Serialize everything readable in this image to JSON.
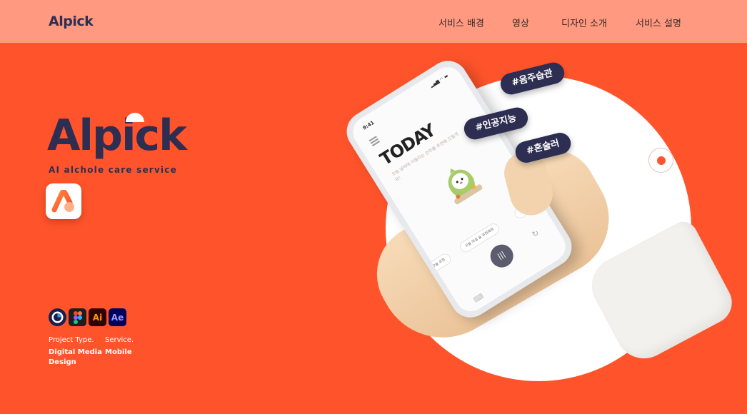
{
  "header": {
    "logo": "Alpick",
    "nav": [
      "서비스 배경",
      "영상",
      "디자인 소개",
      "서비스 설명"
    ]
  },
  "hero": {
    "logo": "Alpick",
    "tagline": "AI alchole care service",
    "tools": [
      {
        "icon": "cinema4d-icon",
        "label": ""
      },
      {
        "icon": "figma-icon",
        "label": ""
      },
      {
        "icon": "illustrator-icon",
        "label": "Ai"
      },
      {
        "icon": "after-effects-icon",
        "label": "Ae"
      }
    ],
    "project_type_label": "Project Type.",
    "project_type_value": "Digital Media Design",
    "service_label": "Service.",
    "service_value": "Mobile"
  },
  "phone": {
    "time": "9:41",
    "status": "▂▄▆ ◠ ▬",
    "title": "TODAY",
    "subtitle": "오늘 날씨에 어울리는 안주를 추천해 드릴게요!",
    "chips": [
      "오늘 추천",
      "오늘 마실 술 추천해줘",
      "오늘"
    ],
    "mic": "|||",
    "refresh": "↻",
    "keyboard": "⌨"
  },
  "tags": [
    "#음주습관",
    "#인공지능",
    "#혼술러"
  ],
  "colors": {
    "background": "#ff542b",
    "header": "#ff9a80",
    "brand_dark": "#2e2e52"
  }
}
